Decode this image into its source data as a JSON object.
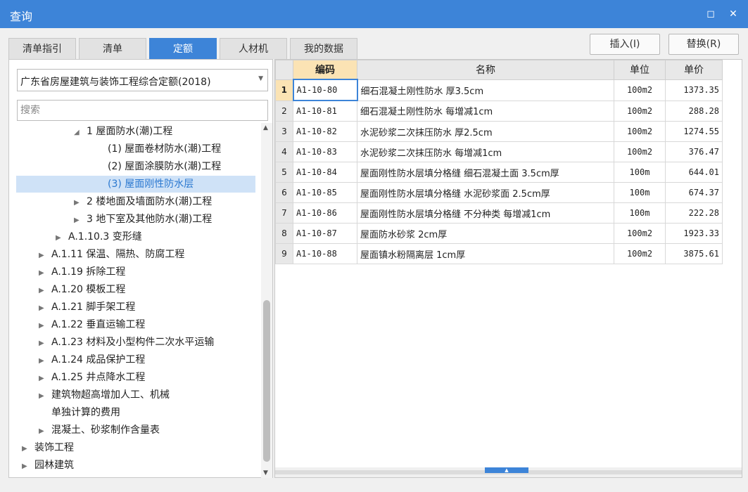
{
  "window": {
    "title": "查询",
    "maximize_icon": "maximize-icon",
    "close_icon": "close-icon",
    "accent_color": "#3d84d8"
  },
  "tabs": [
    {
      "label": "清单指引"
    },
    {
      "label": "清单"
    },
    {
      "label": "定额",
      "active": true
    },
    {
      "label": "人材机"
    },
    {
      "label": "我的数据"
    }
  ],
  "actions": {
    "insert_label": "插入(I)",
    "replace_label": "替换(R)"
  },
  "left": {
    "library": "广东省房屋建筑与装饰工程综合定额(2018)",
    "search_placeholder": "搜索",
    "tree": [
      {
        "label": "1 屋面防水(潮)工程",
        "arrow": "◢"
      },
      {
        "label": "(1) 屋面卷材防水(潮)工程",
        "arrow": ""
      },
      {
        "label": "(2) 屋面涂膜防水(潮)工程",
        "arrow": ""
      },
      {
        "label": "(3) 屋面刚性防水层",
        "arrow": "",
        "selected": true
      },
      {
        "label": "2 楼地面及墙面防水(潮)工程",
        "arrow": "▶"
      },
      {
        "label": "3 地下室及其他防水(潮)工程",
        "arrow": "▶"
      },
      {
        "label": "A.1.10.3 变形缝",
        "arrow": "▶"
      },
      {
        "label": "A.1.11 保温、隔热、防腐工程",
        "arrow": "▶"
      },
      {
        "label": "A.1.19 拆除工程",
        "arrow": "▶"
      },
      {
        "label": "A.1.20 模板工程",
        "arrow": "▶"
      },
      {
        "label": "A.1.21 脚手架工程",
        "arrow": "▶"
      },
      {
        "label": "A.1.22 垂直运输工程",
        "arrow": "▶"
      },
      {
        "label": "A.1.23 材料及小型构件二次水平运输",
        "arrow": "▶"
      },
      {
        "label": "A.1.24 成品保护工程",
        "arrow": "▶"
      },
      {
        "label": "A.1.25 井点降水工程",
        "arrow": "▶"
      },
      {
        "label": "建筑物超高增加人工、机械",
        "arrow": "▶"
      },
      {
        "label": "单独计算的费用",
        "arrow": ""
      },
      {
        "label": "混凝土、砂浆制作含量表",
        "arrow": "▶"
      },
      {
        "label": "装饰工程",
        "arrow": "▶"
      },
      {
        "label": "园林建筑",
        "arrow": "▶"
      }
    ]
  },
  "grid": {
    "headers": {
      "code": "编码",
      "name": "名称",
      "unit": "单位",
      "price": "单价"
    },
    "rows": [
      {
        "no": "1",
        "code": "A1-10-80",
        "name": "细石混凝土刚性防水 厚3.5cm",
        "unit": "100m2",
        "price": "1373.35"
      },
      {
        "no": "2",
        "code": "A1-10-81",
        "name": "细石混凝土刚性防水 每增减1cm",
        "unit": "100m2",
        "price": "288.28"
      },
      {
        "no": "3",
        "code": "A1-10-82",
        "name": "水泥砂浆二次抹压防水 厚2.5cm",
        "unit": "100m2",
        "price": "1274.55"
      },
      {
        "no": "4",
        "code": "A1-10-83",
        "name": "水泥砂浆二次抹压防水 每增减1cm",
        "unit": "100m2",
        "price": "376.47"
      },
      {
        "no": "5",
        "code": "A1-10-84",
        "name": "屋面刚性防水层填分格缝 细石混凝土面 3.5cm厚",
        "unit": "100m",
        "price": "644.01"
      },
      {
        "no": "6",
        "code": "A1-10-85",
        "name": "屋面刚性防水层填分格缝 水泥砂浆面 2.5cm厚",
        "unit": "100m",
        "price": "674.37"
      },
      {
        "no": "7",
        "code": "A1-10-86",
        "name": "屋面刚性防水层填分格缝 不分种类 每增减1cm",
        "unit": "100m",
        "price": "222.28"
      },
      {
        "no": "8",
        "code": "A1-10-87",
        "name": "屋面防水砂浆 2cm厚",
        "unit": "100m2",
        "price": "1923.33"
      },
      {
        "no": "9",
        "code": "A1-10-88",
        "name": "屋面镇水粉隔离层 1cm厚",
        "unit": "100m2",
        "price": "3875.61"
      }
    ]
  }
}
